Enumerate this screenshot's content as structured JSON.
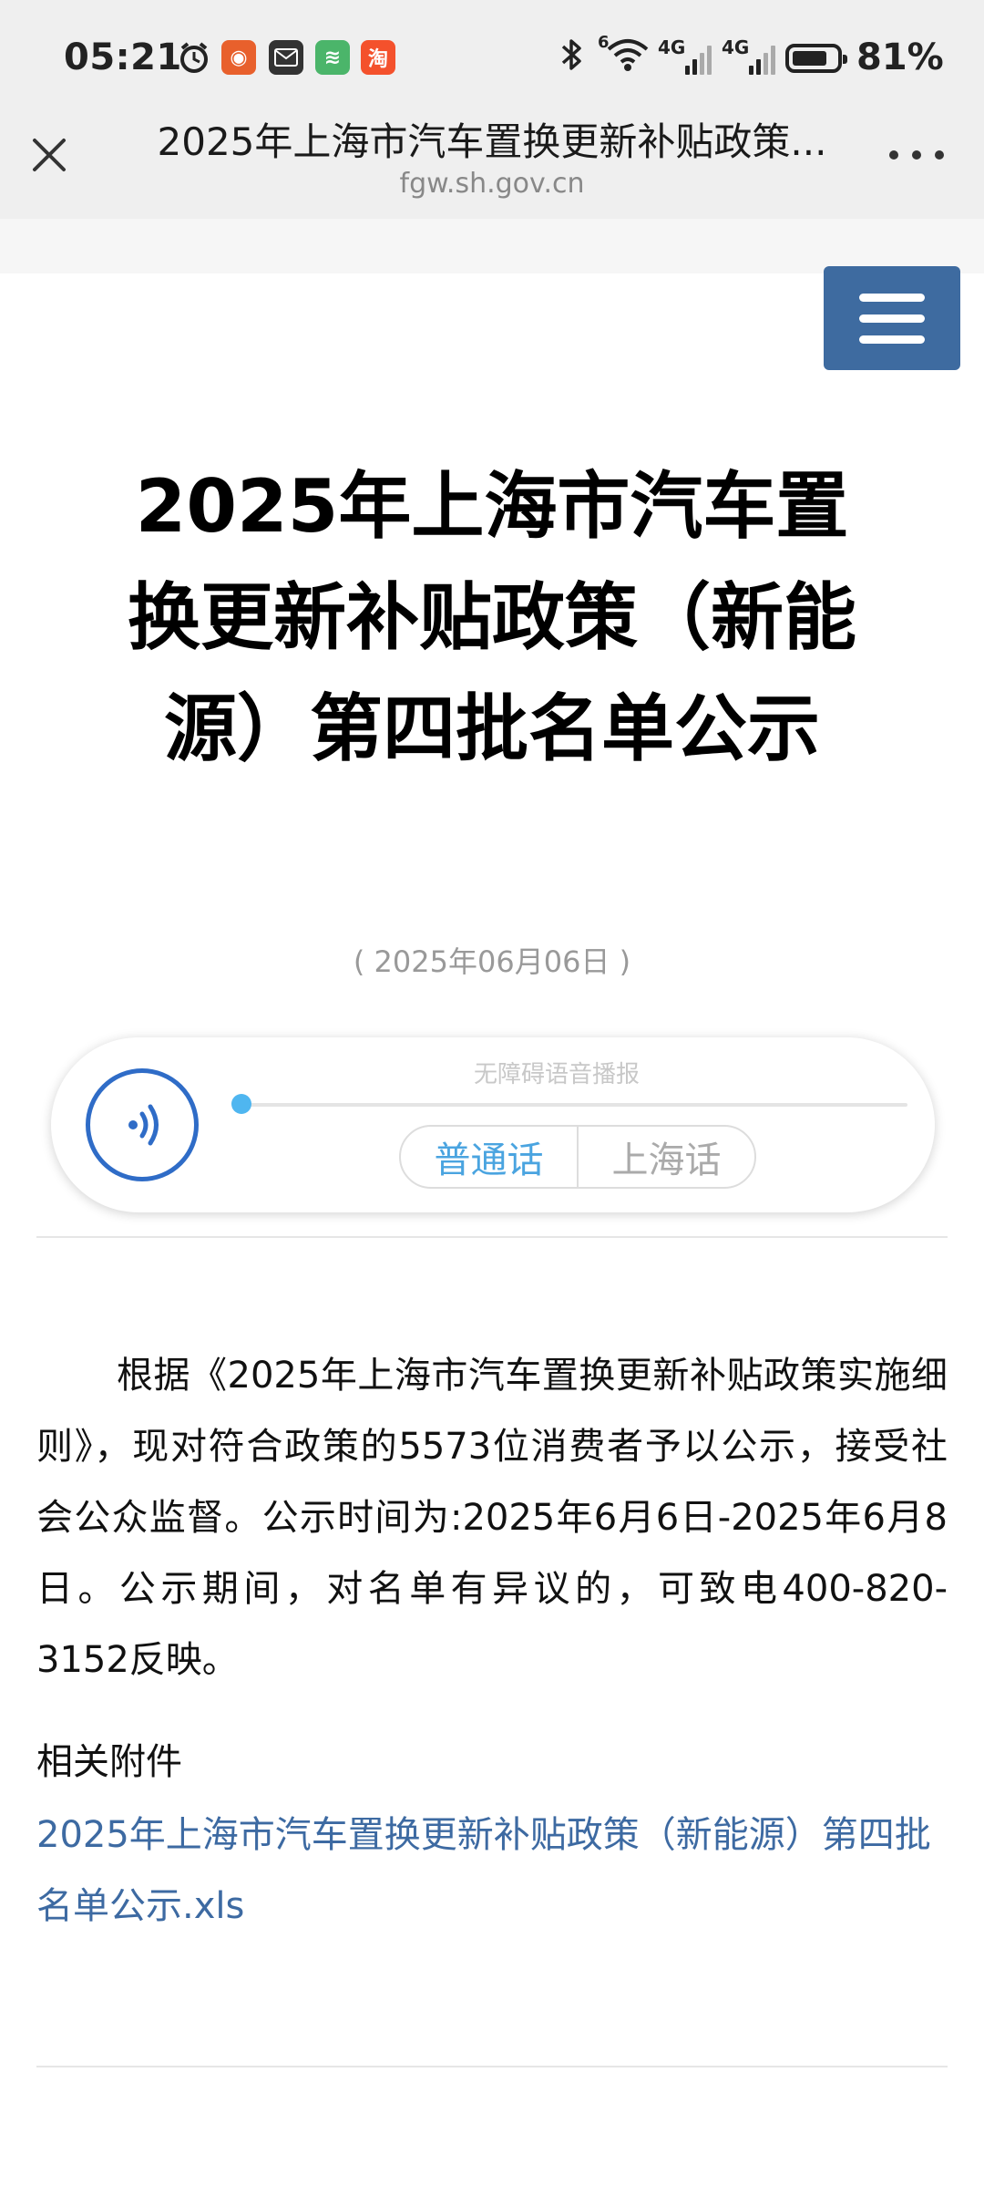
{
  "status_bar": {
    "time": "05:21",
    "battery_percent": "81%",
    "battery_level": 0.81,
    "network_1": "4G",
    "network_2": "4G",
    "wifi_badge": "6"
  },
  "nav": {
    "title": "2025年上海市汽车置换更新补贴政策...",
    "url": "fgw.sh.gov.cn"
  },
  "article": {
    "title": "2025年上海市汽车置换更新补贴政策（新能源）第四批名单公示",
    "date": "( 2025年06月06日 )",
    "body": "根据《2025年上海市汽车置换更新补贴政策实施细则》，现对符合政策的5573位消费者予以公示，接受社会公众监督。公示时间为:2025年6月6日-2025年6月8日。公示期间，对名单有异议的，可致电400-820-3152反映。",
    "attachments_heading": "相关附件",
    "attachment_link": "2025年上海市汽车置换更新补贴政策（新能源）第四批名单公示.xls"
  },
  "audio_player": {
    "label": "无障碍语音播报",
    "lang_mandarin": "普通话",
    "lang_shanghainese": "上海话",
    "progress": 0
  },
  "colors": {
    "menu_button": "#3e6ba0",
    "link": "#3d6aa2",
    "active_lang": "#4aa4e0",
    "play_ring": "#2f6cc7"
  }
}
